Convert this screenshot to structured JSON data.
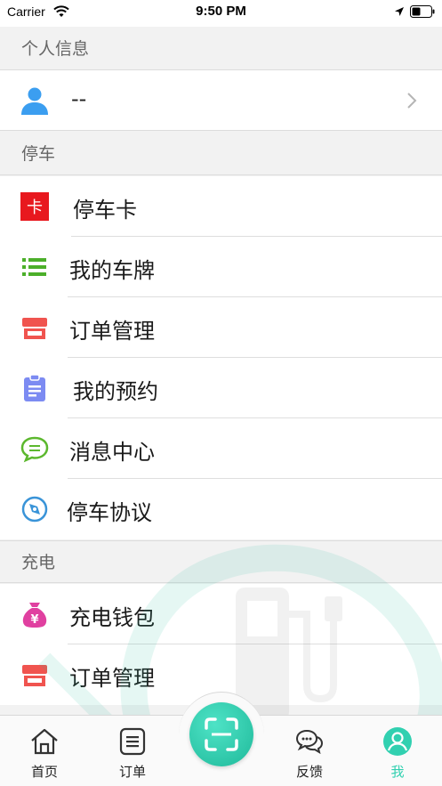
{
  "status_bar": {
    "carrier": "Carrier",
    "time": "9:50 PM"
  },
  "sections": {
    "personal": {
      "title": "个人信息",
      "user_name": "--"
    },
    "parking": {
      "title": "停车",
      "items": [
        {
          "label": "停车卡",
          "icon": "parking-card-icon",
          "icon_text": "卡",
          "color": "#e8181e"
        },
        {
          "label": "我的车牌",
          "icon": "list-icon",
          "color": "#4caf2a"
        },
        {
          "label": "订单管理",
          "icon": "store-icon",
          "color": "#f0544f"
        },
        {
          "label": "我的预约",
          "icon": "clipboard-icon",
          "color": "#7c8bf2"
        },
        {
          "label": "消息中心",
          "icon": "chat-bubble-icon",
          "color": "#5cb82e"
        },
        {
          "label": "停车协议",
          "icon": "compass-icon",
          "color": "#3a94d8"
        }
      ]
    },
    "charging": {
      "title": "充电",
      "items": [
        {
          "label": "充电钱包",
          "icon": "money-bag-icon",
          "icon_text": "¥",
          "color": "#e040a0"
        },
        {
          "label": "订单管理",
          "icon": "store-icon",
          "color": "#f0544f"
        }
      ]
    }
  },
  "tab_bar": {
    "tabs": [
      {
        "label": "首页",
        "icon": "home-icon"
      },
      {
        "label": "订单",
        "icon": "order-list-icon"
      },
      {
        "label": "反馈",
        "icon": "feedback-icon"
      },
      {
        "label": "我",
        "icon": "profile-icon",
        "active": true
      }
    ],
    "scan": {
      "icon": "scan-icon"
    },
    "accent_color": "#31d0b0"
  }
}
